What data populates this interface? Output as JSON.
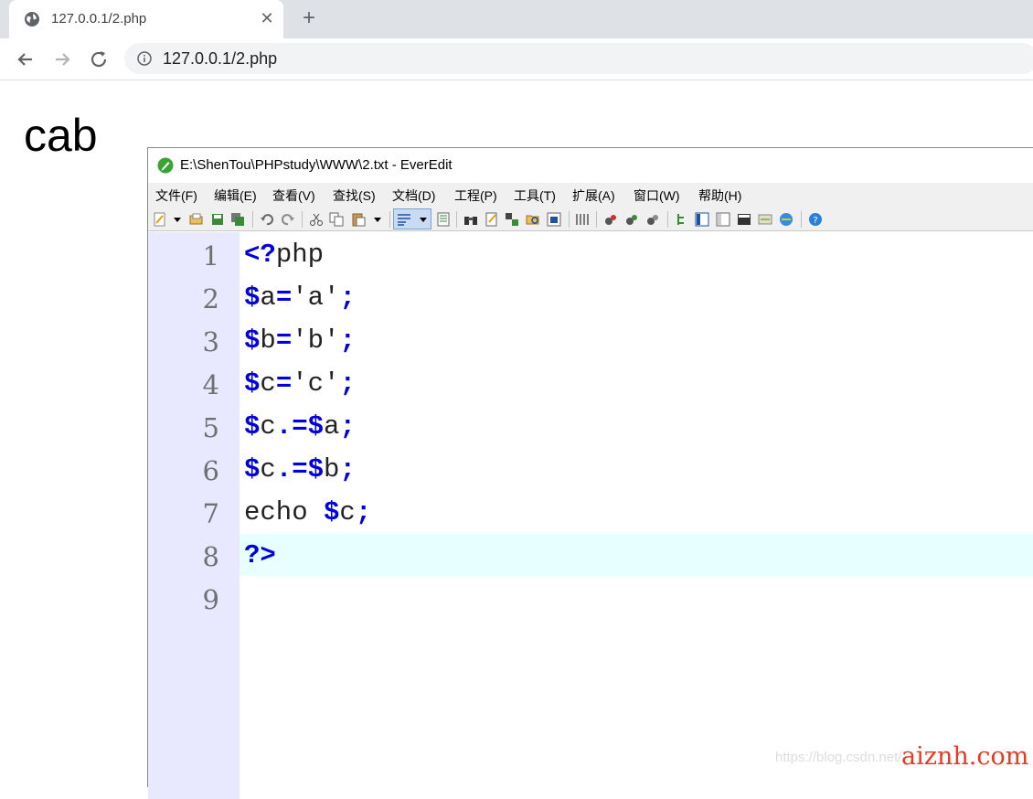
{
  "browser": {
    "tab": {
      "title": "127.0.0.1/2.php",
      "close": "✕",
      "favicon": "globe-icon"
    },
    "new_tab": "+",
    "address": {
      "url": "127.0.0.1/2.php",
      "icon": "info-icon"
    }
  },
  "page": {
    "output": "cab"
  },
  "editor": {
    "title": "E:\\ShenTou\\PHPstudy\\WWW\\2.txt - EverEdit",
    "menus": [
      "文件(F)",
      "编辑(E)",
      "查看(V)",
      "查找(S)",
      "文档(D)",
      "工程(P)",
      "工具(T)",
      "扩展(A)",
      "窗口(W)",
      "帮助(H)"
    ],
    "line_numbers": [
      "1",
      "2",
      "3",
      "4",
      "5",
      "6",
      "7",
      "8",
      "9"
    ],
    "code": [
      [
        {
          "t": "<?",
          "k": true
        },
        {
          "t": "php",
          "k": false
        }
      ],
      [
        {
          "t": "$",
          "k": true
        },
        {
          "t": "a",
          "k": false
        },
        {
          "t": "=",
          "k": true
        },
        {
          "t": "'a'",
          "k": false
        },
        {
          "t": ";",
          "k": true
        }
      ],
      [
        {
          "t": "$",
          "k": true
        },
        {
          "t": "b",
          "k": false
        },
        {
          "t": "=",
          "k": true
        },
        {
          "t": "'b'",
          "k": false
        },
        {
          "t": ";",
          "k": true
        }
      ],
      [
        {
          "t": "$",
          "k": true
        },
        {
          "t": "c",
          "k": false
        },
        {
          "t": "=",
          "k": true
        },
        {
          "t": "'c'",
          "k": false
        },
        {
          "t": ";",
          "k": true
        }
      ],
      [
        {
          "t": "$",
          "k": true
        },
        {
          "t": "c",
          "k": false
        },
        {
          "t": ".=$",
          "k": true
        },
        {
          "t": "a",
          "k": false
        },
        {
          "t": ";",
          "k": true
        }
      ],
      [
        {
          "t": "$",
          "k": true
        },
        {
          "t": "c",
          "k": false
        },
        {
          "t": ".=$",
          "k": true
        },
        {
          "t": "b",
          "k": false
        },
        {
          "t": ";",
          "k": true
        }
      ],
      [
        {
          "t": "echo ",
          "k": false
        },
        {
          "t": "$",
          "k": true
        },
        {
          "t": "c",
          "k": false
        },
        {
          "t": ";",
          "k": true
        }
      ],
      [
        {
          "t": "?>",
          "k": true
        }
      ],
      []
    ],
    "current_line": 8
  },
  "watermarks": {
    "csdn": "https://blog.csdn.net/...",
    "aiznh": "aiznh.com"
  },
  "colors": {
    "keyword": "#0000dd",
    "gutter": "#e8e8ff",
    "current_line": "#e8ffff",
    "watermark": "#e83a1f"
  }
}
